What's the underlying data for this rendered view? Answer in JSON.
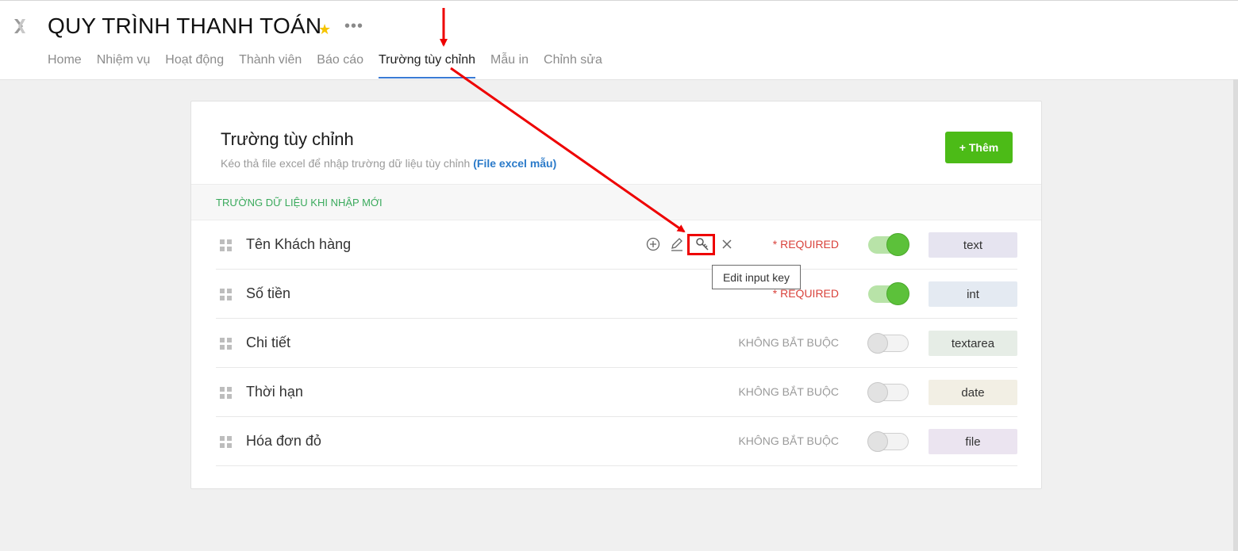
{
  "header": {
    "title": "QUY TRÌNH THANH TOÁN",
    "star_icon": "star-icon",
    "more_icon": "more-dots-icon",
    "logo_icon": "app-logo-icon",
    "star_color": "#f5c400",
    "tabs": [
      {
        "label": "Home",
        "active": false
      },
      {
        "label": "Nhiệm vụ",
        "active": false
      },
      {
        "label": "Hoạt động",
        "active": false
      },
      {
        "label": "Thành viên",
        "active": false
      },
      {
        "label": "Báo cáo",
        "active": false
      },
      {
        "label": "Trường tùy chỉnh",
        "active": true
      },
      {
        "label": "Mẫu in",
        "active": false
      },
      {
        "label": "Chỉnh sửa",
        "active": false
      }
    ]
  },
  "card": {
    "title": "Trường tùy chỉnh",
    "subtitle": "Kéo thả file excel để nhập trường dữ liệu tùy chỉnh",
    "subtitle_link": "(File excel mẫu)",
    "add_button": "+ Thêm",
    "section_label": "TRƯỜNG DỮ LIỆU KHI NHẬP MỚI",
    "accent_color": "#4cbb17",
    "rows": [
      {
        "label": "Tên Khách hàng",
        "requirement": "* REQUIRED",
        "required": true,
        "enabled": true,
        "type": "text",
        "type_bg": "#e6e4f0"
      },
      {
        "label": "Số tiền",
        "requirement": "* REQUIRED",
        "required": true,
        "enabled": true,
        "type": "int",
        "type_bg": "#e4eaf2"
      },
      {
        "label": "Chi tiết",
        "requirement": "KHÔNG BẮT BUỘC",
        "required": false,
        "enabled": false,
        "type": "textarea",
        "type_bg": "#e6ede6"
      },
      {
        "label": "Thời hạn",
        "requirement": "KHÔNG BẮT BUỘC",
        "required": false,
        "enabled": false,
        "type": "date",
        "type_bg": "#f2efe4"
      },
      {
        "label": "Hóa đơn đỏ",
        "requirement": "KHÔNG BẮT BUỘC",
        "required": false,
        "enabled": false,
        "type": "file",
        "type_bg": "#ebe4f0"
      }
    ],
    "row_actions": [
      "add-circle-icon",
      "edit-pencil-icon",
      "key-icon",
      "close-icon"
    ]
  },
  "tooltip": {
    "text": "Edit input key"
  },
  "annotation_color": "#ee0000"
}
